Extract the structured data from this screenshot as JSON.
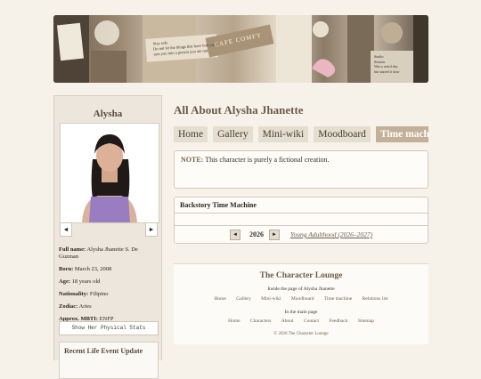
{
  "banner": {
    "note_lines": [
      "Stay safe.",
      "Do not let the things that have hurt you",
      "turn you into a person you are not."
    ],
    "sign_text": "CAFE COMFY",
    "right_note_lines": [
      "Studio",
      "Session",
      "Was a weird day",
      "but started it slow"
    ]
  },
  "sidebar": {
    "name": "Alysha",
    "prev_icon": "◄",
    "next_icon": "►",
    "facts": [
      {
        "label": "Full name:",
        "value": "Alysha Jhanette S. De Guzman"
      },
      {
        "label": "Born:",
        "value": "March 23, 2008"
      },
      {
        "label": "Age:",
        "value": "18 years old"
      },
      {
        "label": "Nationality:",
        "value": "Filipino"
      },
      {
        "label": "Zodiac:",
        "value": "Aries"
      },
      {
        "label": "Approx. MBTI:",
        "value": "ENFP"
      }
    ],
    "stats_button": "Show Her Physical Stats",
    "life_event_title": "Recent Life Event Update"
  },
  "main": {
    "title": "All About Alysha Jhanette",
    "tabs": [
      "Home",
      "Gallery",
      "Mini-wiki",
      "Moodboard",
      "Time machine"
    ],
    "active_tab": 4,
    "note": {
      "label": "NOTE:",
      "text": " This character is purely a fictional creation."
    },
    "time_machine": {
      "title": "Backstory Time Machine",
      "prev_icon": "◄",
      "next_icon": "►",
      "year": "2026",
      "era": "Young Adulthood (2026–2027)"
    }
  },
  "footer": {
    "title": "The Character Lounge",
    "inside_label": "Inside the page of Alysha Jhanette",
    "inside_links": [
      "Home",
      "Gallery",
      "Mini-wiki",
      "Moodboard",
      "Time machine",
      "Relations list"
    ],
    "main_label": "In the main page",
    "main_links": [
      "Home",
      "Characters",
      "About",
      "Contact",
      "Feedback",
      "Sitemap"
    ],
    "copyright": "© 2026 The Character Lounge"
  },
  "colors": {
    "background": "#f6f2ea",
    "accent": "#6b5a48",
    "active_tab": "#c2b098",
    "dress": "#9a7cc1"
  }
}
